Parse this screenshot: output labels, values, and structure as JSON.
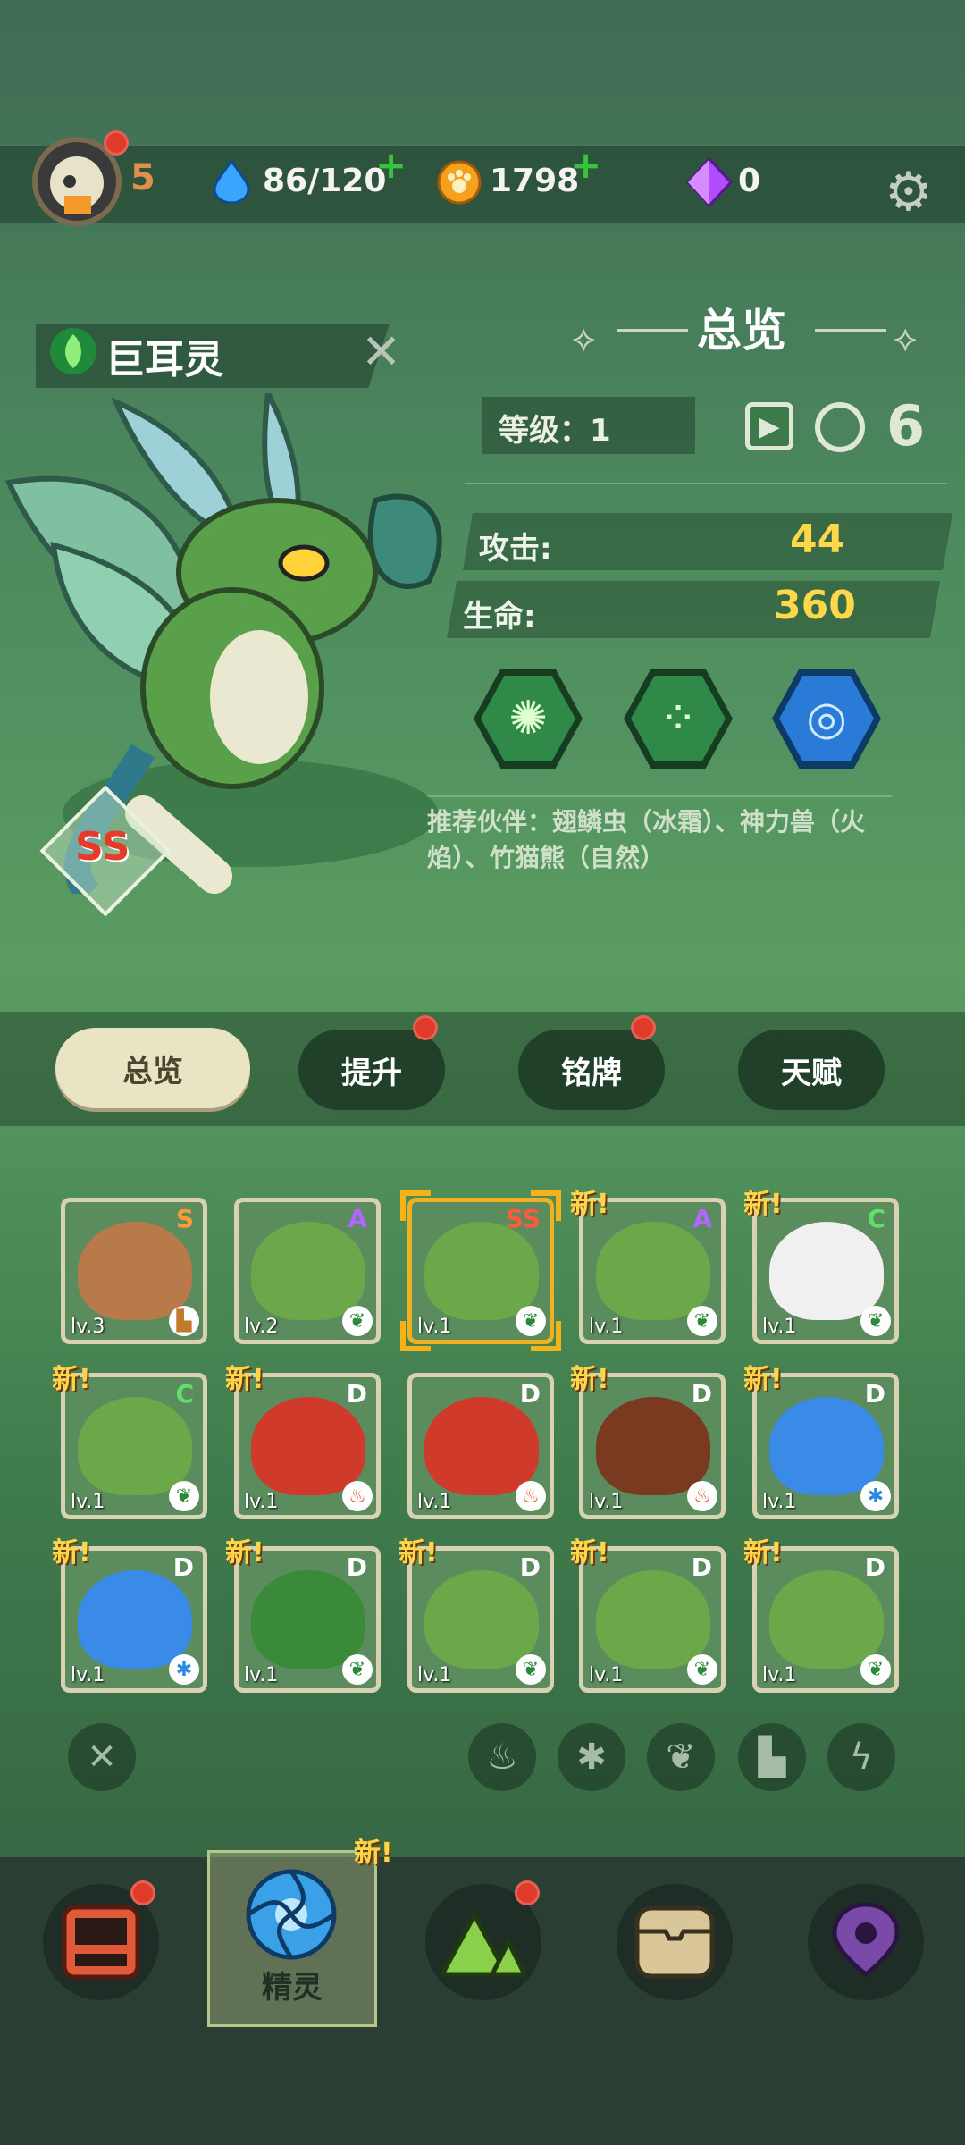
{
  "header": {
    "player_level": "5",
    "water": "86/120",
    "coins": "1798",
    "gems": "0",
    "plus": "+"
  },
  "elf": {
    "name": "巨耳灵",
    "rank": "SS",
    "section_title": "总览",
    "level_label": "等级：1",
    "stats": [
      {
        "label": "攻击:",
        "value": "44"
      },
      {
        "label": "生命:",
        "value": "360"
      }
    ],
    "recommend": "推荐伙伴：翅鳞虫（冰霜）、神力兽（火焰）、竹猫熊（自然）"
  },
  "tabs": [
    {
      "label": "总览",
      "active": true,
      "dot": false
    },
    {
      "label": "提升",
      "active": false,
      "dot": true
    },
    {
      "label": "铭牌",
      "active": false,
      "dot": true
    },
    {
      "label": "天赋",
      "active": false,
      "dot": false
    }
  ],
  "cards": [
    {
      "rank": "S",
      "lv": "lv.3",
      "elem": "earth",
      "new": false,
      "art": "dog"
    },
    {
      "rank": "A",
      "lv": "lv.2",
      "elem": "leaf",
      "new": false,
      "art": "rabbit"
    },
    {
      "rank": "SS",
      "lv": "lv.1",
      "elem": "leaf",
      "new": false,
      "art": "rabbit",
      "selected": true
    },
    {
      "rank": "A",
      "lv": "lv.1",
      "elem": "leaf",
      "new": true,
      "art": "rabbit"
    },
    {
      "rank": "C",
      "lv": "lv.1",
      "elem": "leaf",
      "new": true,
      "art": "panda"
    },
    {
      "rank": "C",
      "lv": "lv.1",
      "elem": "leaf",
      "new": true,
      "art": "rabbit"
    },
    {
      "rank": "D",
      "lv": "lv.1",
      "elem": "fire",
      "new": true,
      "art": "red"
    },
    {
      "rank": "D",
      "lv": "lv.1",
      "elem": "fire",
      "new": false,
      "art": "red"
    },
    {
      "rank": "D",
      "lv": "lv.1",
      "elem": "fire",
      "new": true,
      "art": "robot"
    },
    {
      "rank": "D",
      "lv": "lv.1",
      "elem": "ice",
      "new": true,
      "art": "blue"
    },
    {
      "rank": "D",
      "lv": "lv.1",
      "elem": "ice",
      "new": true,
      "art": "blue"
    },
    {
      "rank": "D",
      "lv": "lv.1",
      "elem": "leaf",
      "new": true,
      "art": "parrot"
    },
    {
      "rank": "D",
      "lv": "lv.1",
      "elem": "leaf",
      "new": true,
      "art": "rabbit"
    },
    {
      "rank": "D",
      "lv": "lv.1",
      "elem": "leaf",
      "new": true,
      "art": "rabbit"
    },
    {
      "rank": "D",
      "lv": "lv.1",
      "elem": "leaf",
      "new": true,
      "art": "rabbit"
    }
  ],
  "new_badge": "新!",
  "filters": [
    "clear-icon",
    "fire-icon",
    "ice-icon",
    "leaf-icon",
    "earth-icon",
    "lightning-icon"
  ],
  "nav": {
    "active_label": "精灵",
    "new_badge": "新!",
    "items": [
      "shop-icon",
      "elf-icon",
      "adventure-icon",
      "chest-icon",
      "map-icon"
    ]
  },
  "colors": {
    "rank_S": "#ff9a3a",
    "rank_A": "#b066ff",
    "rank_SS": "#ff5a3a",
    "rank_C": "#5fe06a",
    "rank_D": "#ffffff",
    "stat_value": "#ffd84a"
  }
}
